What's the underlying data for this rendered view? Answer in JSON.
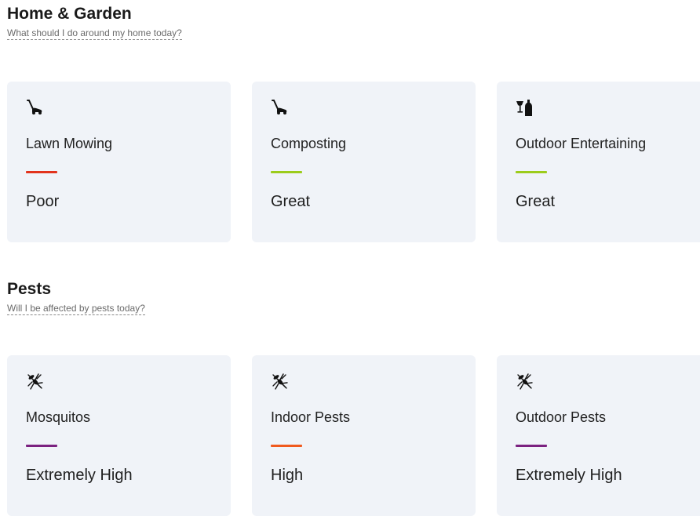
{
  "home_garden": {
    "title": "Home & Garden",
    "subtitle": "What should I do around my home today?",
    "cards": [
      {
        "icon": "lawn-mower-icon",
        "title": "Lawn Mowing",
        "rating": "Poor",
        "rule_color": "#e2331c"
      },
      {
        "icon": "lawn-mower-icon",
        "title": "Composting",
        "rating": "Great",
        "rule_color": "#9ccc1b"
      },
      {
        "icon": "wine-glass-bottle-icon",
        "title": "Outdoor Entertaining",
        "rating": "Great",
        "rule_color": "#9ccc1b"
      }
    ]
  },
  "pests": {
    "title": "Pests",
    "subtitle": "Will I be affected by pests today?",
    "cards": [
      {
        "icon": "mosquito-icon",
        "title": "Mosquitos",
        "rating": "Extremely High",
        "rule_color": "#7b2180"
      },
      {
        "icon": "mosquito-icon",
        "title": "Indoor Pests",
        "rating": "High",
        "rule_color": "#f05a1e"
      },
      {
        "icon": "mosquito-icon",
        "title": "Outdoor Pests",
        "rating": "Extremely High",
        "rule_color": "#7b2180"
      }
    ]
  }
}
